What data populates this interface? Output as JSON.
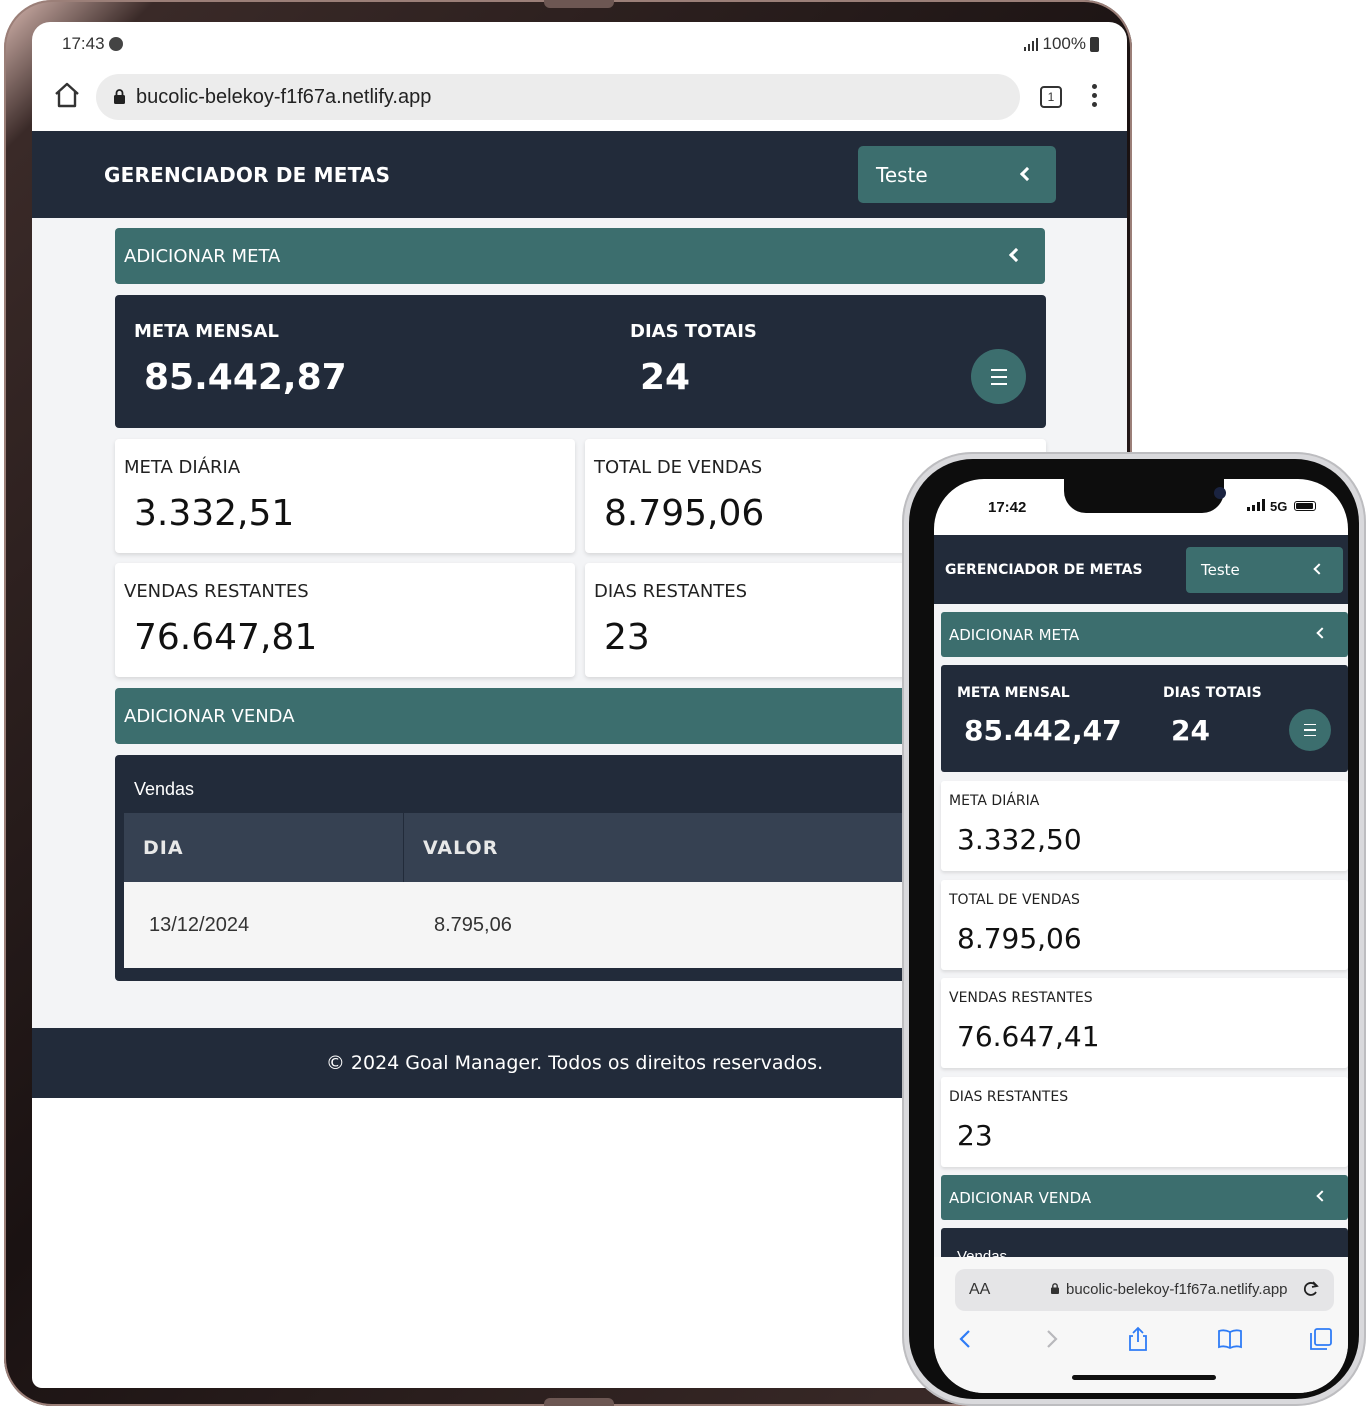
{
  "tablet": {
    "status": {
      "time": "17:43",
      "battery": "100%"
    },
    "browser": {
      "url": "bucolic-belekoy-f1f67a.netlify.app",
      "tab_count": "1"
    },
    "header": {
      "brand": "GERENCIADOR DE METAS",
      "user_button": "Teste"
    },
    "add_goal": "ADICIONAR META",
    "summary": {
      "monthly_goal_label": "META MENSAL",
      "monthly_goal_value": "85.442,87",
      "total_days_label": "DIAS TOTAIS",
      "total_days_value": "24"
    },
    "cards": {
      "daily_goal_label": "META DIÁRIA",
      "daily_goal_value": "3.332,51",
      "total_sales_label": "TOTAL DE VENDAS",
      "total_sales_value": "8.795,06",
      "remaining_sales_label": "VENDAS RESTANTES",
      "remaining_sales_value": "76.647,81",
      "remaining_days_label": "DIAS RESTANTES",
      "remaining_days_value": "23"
    },
    "add_sale": "ADICIONAR VENDA",
    "sales": {
      "title": "Vendas",
      "columns": [
        "DIA",
        "VALOR"
      ],
      "rows": [
        {
          "day": "13/12/2024",
          "value": "8.795,06"
        }
      ]
    },
    "footer": "© 2024 Goal Manager. Todos os direitos reservados."
  },
  "phone": {
    "status": {
      "time": "17:42",
      "network": "5G"
    },
    "header": {
      "brand": "GERENCIADOR DE METAS",
      "user_button": "Teste"
    },
    "add_goal": "ADICIONAR META",
    "summary": {
      "monthly_goal_label": "META MENSAL",
      "monthly_goal_value": "85.442,47",
      "total_days_label": "DIAS TOTAIS",
      "total_days_value": "24"
    },
    "cards": [
      {
        "label": "META DIÁRIA",
        "value": "3.332,50"
      },
      {
        "label": "TOTAL DE VENDAS",
        "value": "8.795,06"
      },
      {
        "label": "VENDAS RESTANTES",
        "value": "76.647,41"
      },
      {
        "label": "DIAS RESTANTES",
        "value": "23"
      }
    ],
    "add_sale": "ADICIONAR VENDA",
    "sales_title": "Vendas",
    "safari": {
      "aa": "AA",
      "url": "bucolic-belekoy-f1f67a.netlify.app"
    }
  },
  "colors": {
    "navy": "#222b3a",
    "teal": "#3c6e6e",
    "page_bg": "#f3f4f6"
  }
}
